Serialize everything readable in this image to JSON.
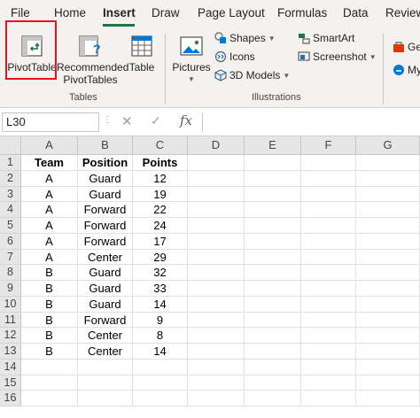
{
  "menu": {
    "tabs": [
      "File",
      "Home",
      "Insert",
      "Draw",
      "Page Layout",
      "Formulas",
      "Data",
      "Review"
    ],
    "active": "Insert"
  },
  "ribbon": {
    "tables": {
      "pivottable_label": "PivotTable",
      "recommended_label_line1": "Recommended",
      "recommended_label_line2": "PivotTables",
      "table_label": "Table",
      "group_label": "Tables"
    },
    "illustrations": {
      "pictures_label": "Pictures",
      "shapes_label": "Shapes",
      "icons_label": "Icons",
      "models_label": "3D Models",
      "smartart_label": "SmartArt",
      "screenshot_label": "Screenshot",
      "group_label": "Illustrations"
    },
    "addins": {
      "get_label": "Ge",
      "my_label": "My"
    }
  },
  "formula_bar": {
    "name_box": "L30",
    "cancel_symbol": "✕",
    "enter_symbol": "✓",
    "fx_symbol": "fx",
    "formula": ""
  },
  "sheet": {
    "columns": [
      "A",
      "B",
      "C",
      "D",
      "E",
      "F",
      "G"
    ],
    "row_numbers": [
      "1",
      "2",
      "3",
      "4",
      "5",
      "6",
      "7",
      "8",
      "9",
      "10",
      "11",
      "12",
      "13",
      "14",
      "15",
      "16"
    ],
    "rows": [
      [
        "Team",
        "Position",
        "Points"
      ],
      [
        "A",
        "Guard",
        "12"
      ],
      [
        "A",
        "Guard",
        "19"
      ],
      [
        "A",
        "Forward",
        "22"
      ],
      [
        "A",
        "Forward",
        "24"
      ],
      [
        "A",
        "Forward",
        "17"
      ],
      [
        "A",
        "Center",
        "29"
      ],
      [
        "B",
        "Guard",
        "32"
      ],
      [
        "B",
        "Guard",
        "33"
      ],
      [
        "B",
        "Guard",
        "14"
      ],
      [
        "B",
        "Forward",
        "9"
      ],
      [
        "B",
        "Center",
        "8"
      ],
      [
        "B",
        "Center",
        "14"
      ],
      [
        "",
        "",
        ""
      ],
      [
        "",
        "",
        ""
      ],
      [
        "",
        "",
        ""
      ]
    ]
  },
  "colors": {
    "accent": "#217346",
    "highlight": "#e81123"
  }
}
